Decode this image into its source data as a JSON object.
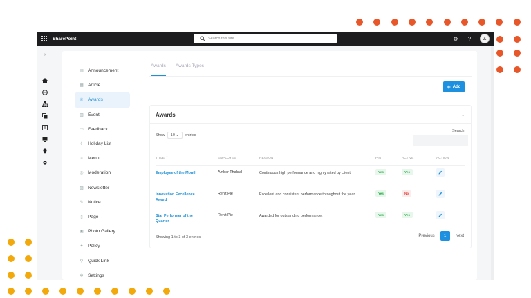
{
  "app": {
    "brand": "SharePoint"
  },
  "search": {
    "placeholder": "Search this site"
  },
  "topbar_icons": [
    "waffle-icon",
    "gear-icon",
    "help-icon",
    "avatar"
  ],
  "topbar": {
    "help_glyph": "?"
  },
  "sidebar": {
    "items": [
      {
        "label": "Announcement",
        "icon": "announcement-icon",
        "active": false
      },
      {
        "label": "Article",
        "icon": "article-icon",
        "active": false
      },
      {
        "label": "Awards",
        "icon": "trophy-icon",
        "active": true
      },
      {
        "label": "Event",
        "icon": "event-icon",
        "active": false
      },
      {
        "label": "Feedback",
        "icon": "feedback-icon",
        "active": false
      },
      {
        "label": "Holiday List",
        "icon": "holiday-icon",
        "active": false
      },
      {
        "label": "Menu",
        "icon": "menu-icon",
        "active": false
      },
      {
        "label": "Moderation",
        "icon": "moderation-icon",
        "active": false
      },
      {
        "label": "Newsletter",
        "icon": "newsletter-icon",
        "active": false
      },
      {
        "label": "Notice",
        "icon": "notice-icon",
        "active": false
      },
      {
        "label": "Page",
        "icon": "page-icon",
        "active": false
      },
      {
        "label": "Photo Gallery",
        "icon": "gallery-icon",
        "active": false
      },
      {
        "label": "Policy",
        "icon": "policy-icon",
        "active": false
      },
      {
        "label": "Quick Link",
        "icon": "link-icon",
        "active": false
      },
      {
        "label": "Settings",
        "icon": "settings-icon",
        "active": false
      }
    ]
  },
  "tabs": [
    {
      "label": "Awards",
      "active": true
    },
    {
      "label": "Awards Types",
      "active": false
    }
  ],
  "toolbar": {
    "add_label": "Add"
  },
  "card": {
    "title": "Awards"
  },
  "table_controls": {
    "show_label": "Show",
    "entries_value": "10",
    "entries_label": "entries",
    "search_label": "Search:"
  },
  "table": {
    "headers": [
      "Title",
      "Employee",
      "Reason",
      "PIN",
      "Active",
      "Action"
    ],
    "rows": [
      {
        "title": "Employee of the Month",
        "employee": "Amber Thakral",
        "reason": "Continuous high performance and highly rated by client.",
        "pin": "Yes",
        "active": "Yes"
      },
      {
        "title": "Innovation Excellence Award",
        "employee": "Renit Pie",
        "reason": "Excellent and consistent performance throughout the year",
        "pin": "Yes",
        "active": "No"
      },
      {
        "title": "Star Performer of the Quarter",
        "employee": "Renit Pie",
        "reason": "Awarded for outstanding performance.",
        "pin": "Yes",
        "active": "Yes"
      }
    ]
  },
  "footer": {
    "summary": "Showing 1 to 3 of 3 entries"
  },
  "pager": {
    "previous": "Previous",
    "current": "1",
    "next": "Next"
  },
  "colors": {
    "accent": "#1e90e0",
    "orange_dots": "#e8572a",
    "yellow_dots": "#f2a90c",
    "topbar": "#1d1d1f"
  }
}
